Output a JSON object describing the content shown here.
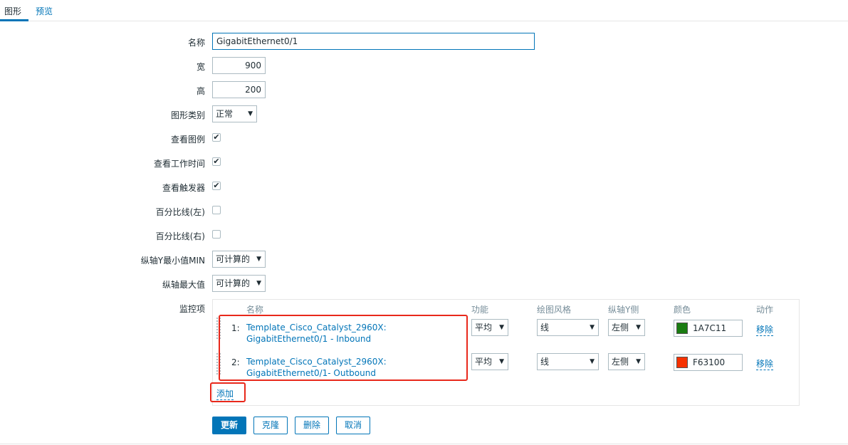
{
  "tabs": {
    "graph": "图形",
    "preview": "预览"
  },
  "form": {
    "name_label": "名称",
    "name_value": "GigabitEthernet0/1",
    "width_label": "宽",
    "width_value": "900",
    "height_label": "高",
    "height_value": "200",
    "graph_type_label": "图形类别",
    "graph_type_value": "正常",
    "show_legend_label": "查看图例",
    "show_legend_checked": true,
    "show_working_time_label": "查看工作时间",
    "show_working_time_checked": true,
    "show_triggers_label": "查看触发器",
    "show_triggers_checked": true,
    "percentile_left_label": "百分比线(左)",
    "percentile_left_checked": false,
    "percentile_right_label": "百分比线(右)",
    "percentile_right_checked": false,
    "y_min_label": "纵轴Y最小值MIN",
    "y_min_value": "可计算的",
    "y_max_label": "纵轴最大值",
    "y_max_value": "可计算的",
    "items_label": "监控项"
  },
  "items_table": {
    "headers": {
      "name": "名称",
      "function": "功能",
      "draw_style": "绘图风格",
      "y_axis_side": "纵轴Y侧",
      "color": "颜色",
      "action": "动作"
    },
    "rows": [
      {
        "index": "1:",
        "name": "Template_Cisco_Catalyst_2960X: GigabitEthernet0/1 - Inbound",
        "function": "平均",
        "draw_style": "线",
        "y_axis_side": "左侧",
        "color_hex": "#1A7C11",
        "color_text": "1A7C11",
        "remove": "移除"
      },
      {
        "index": "2:",
        "name": "Template_Cisco_Catalyst_2960X: GigabitEthernet0/1- Outbound",
        "function": "平均",
        "draw_style": "线",
        "y_axis_side": "左侧",
        "color_hex": "#F63100",
        "color_text": "F63100",
        "remove": "移除"
      }
    ],
    "add_label": "添加"
  },
  "buttons": {
    "update": "更新",
    "clone": "克隆",
    "delete": "删除",
    "cancel": "取消"
  },
  "icons": {
    "checkbox": "check-icon",
    "dropdown": "caret-down-icon"
  },
  "colors": {
    "accent": "#0275b8",
    "highlight": "#e8281b"
  }
}
